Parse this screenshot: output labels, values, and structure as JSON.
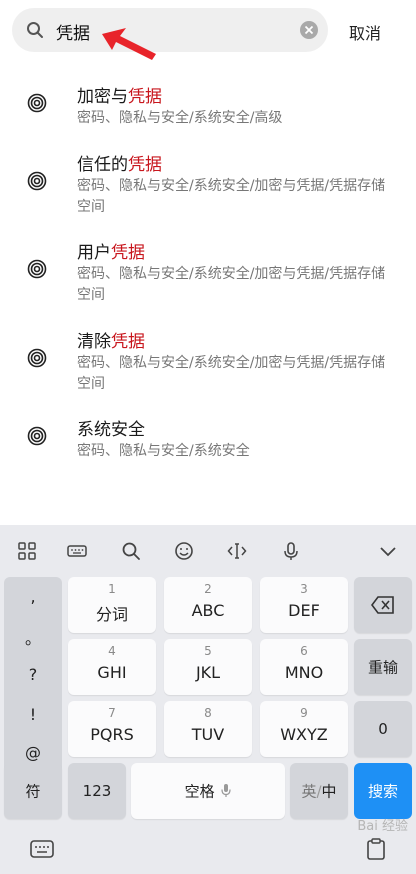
{
  "search": {
    "query": "凭据",
    "cancel_label": "取消"
  },
  "results": [
    {
      "title_pre": "加密与",
      "title_hl": "凭据",
      "path": "密码、隐私与安全/系统安全/高级"
    },
    {
      "title_pre": "信任的",
      "title_hl": "凭据",
      "path": "密码、隐私与安全/系统安全/加密与凭据/凭据存储空间"
    },
    {
      "title_pre": "用户",
      "title_hl": "凭据",
      "path": "密码、隐私与安全/系统安全/加密与凭据/凭据存储空间"
    },
    {
      "title_pre": "清除",
      "title_hl": "凭据",
      "path": "密码、隐私与安全/系统安全/加密与凭据/凭据存储空间"
    },
    {
      "title_pre": "系统安全",
      "title_hl": "",
      "path": "密码、隐私与安全/系统安全"
    }
  ],
  "keyboard": {
    "punctuation": [
      ",",
      "。",
      "?",
      "!",
      "@"
    ],
    "keys": [
      {
        "num": "1",
        "letters": "分词"
      },
      {
        "num": "2",
        "letters": "ABC"
      },
      {
        "num": "3",
        "letters": "DEF"
      },
      {
        "num": "4",
        "letters": "GHI"
      },
      {
        "num": "5",
        "letters": "JKL"
      },
      {
        "num": "6",
        "letters": "MNO"
      },
      {
        "num": "7",
        "letters": "PQRS"
      },
      {
        "num": "8",
        "letters": "TUV"
      },
      {
        "num": "9",
        "letters": "WXYZ"
      }
    ],
    "reenter_label": "重输",
    "zero_label": "0",
    "symbol_label": "符",
    "num_label": "123",
    "space_label": "空格",
    "lang_label_en": "英",
    "lang_label_zh": "中",
    "search_label": "搜索"
  },
  "colors": {
    "highlight": "#c8161d",
    "search_key": "#1e90f5",
    "arrow": "#e8242a"
  },
  "watermark": "Bai 经验"
}
